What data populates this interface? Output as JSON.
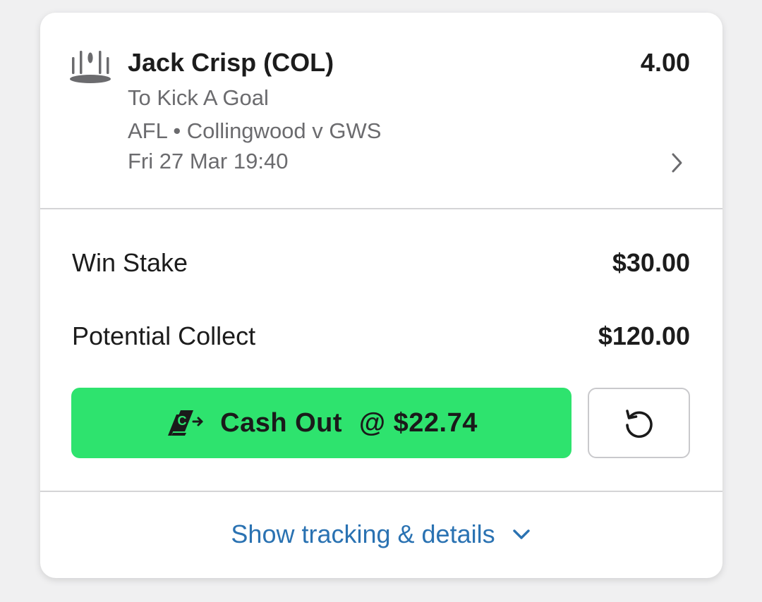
{
  "bet": {
    "selection": "Jack Crisp (COL)",
    "odds": "4.00",
    "market": "To Kick A Goal",
    "event": "AFL • Collingwood v GWS",
    "datetime": "Fri 27 Mar 19:40",
    "sport_icon": "afl-goalposts-icon"
  },
  "summary": {
    "stake_label": "Win Stake",
    "stake_value": "$30.00",
    "collect_label": "Potential Collect",
    "collect_value": "$120.00"
  },
  "cashout": {
    "label": "Cash Out",
    "amount": "@ $22.74",
    "icon": "cash-out-icon",
    "color": "#2ee36e"
  },
  "refresh": {
    "icon": "refresh-icon"
  },
  "details": {
    "label": "Show tracking & details",
    "icon": "chevron-down-icon",
    "color": "#2a72b2"
  }
}
